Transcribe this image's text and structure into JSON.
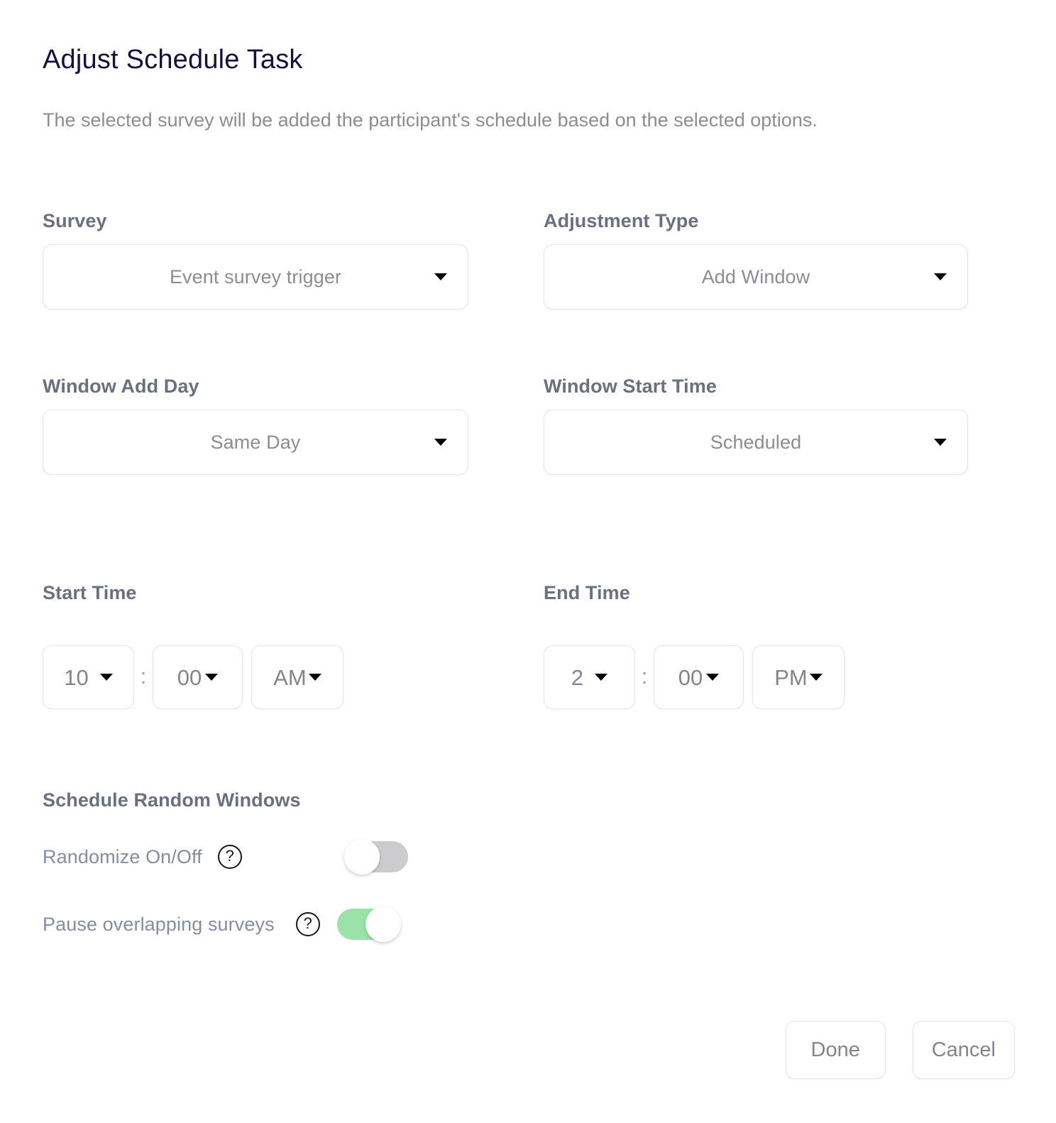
{
  "dialog": {
    "title": "Adjust Schedule Task",
    "description": "The selected survey will be added the participant's schedule based on the selected options."
  },
  "fields": {
    "survey": {
      "label": "Survey",
      "value": "Event survey trigger",
      "caret_icon": "chevron-down-icon"
    },
    "adjustment_type": {
      "label": "Adjustment Type",
      "value": "Add Window",
      "caret_icon": "chevron-down-icon"
    },
    "window_add_day": {
      "label": "Window Add Day",
      "value": "Same Day",
      "caret_icon": "chevron-down-icon"
    },
    "window_start_time": {
      "label": "Window Start Time",
      "value": "Scheduled",
      "caret_icon": "chevron-down-icon"
    }
  },
  "start_time": {
    "label": "Start Time",
    "hour": "10",
    "separator": ":",
    "minute": "00",
    "period": "AM"
  },
  "end_time": {
    "label": "End Time",
    "hour": "2",
    "separator": ":",
    "minute": "00",
    "period": "PM"
  },
  "random_windows": {
    "heading": "Schedule Random Windows",
    "rows": [
      {
        "label": "Randomize On/Off",
        "help_icon": "help-circle-icon",
        "help_glyph": "?",
        "state": "off"
      },
      {
        "label": "Pause overlapping surveys",
        "help_icon": "help-circle-icon",
        "help_glyph": "?",
        "state": "on"
      }
    ]
  },
  "footer": {
    "done_label": "Done",
    "cancel_label": "Cancel"
  },
  "colors": {
    "title": "#14113c",
    "label": "#697080",
    "muted_text": "#8c8c94",
    "toggle_on": "#99e3a8",
    "toggle_off": "#cccccf",
    "border": "#e6e6e8"
  }
}
